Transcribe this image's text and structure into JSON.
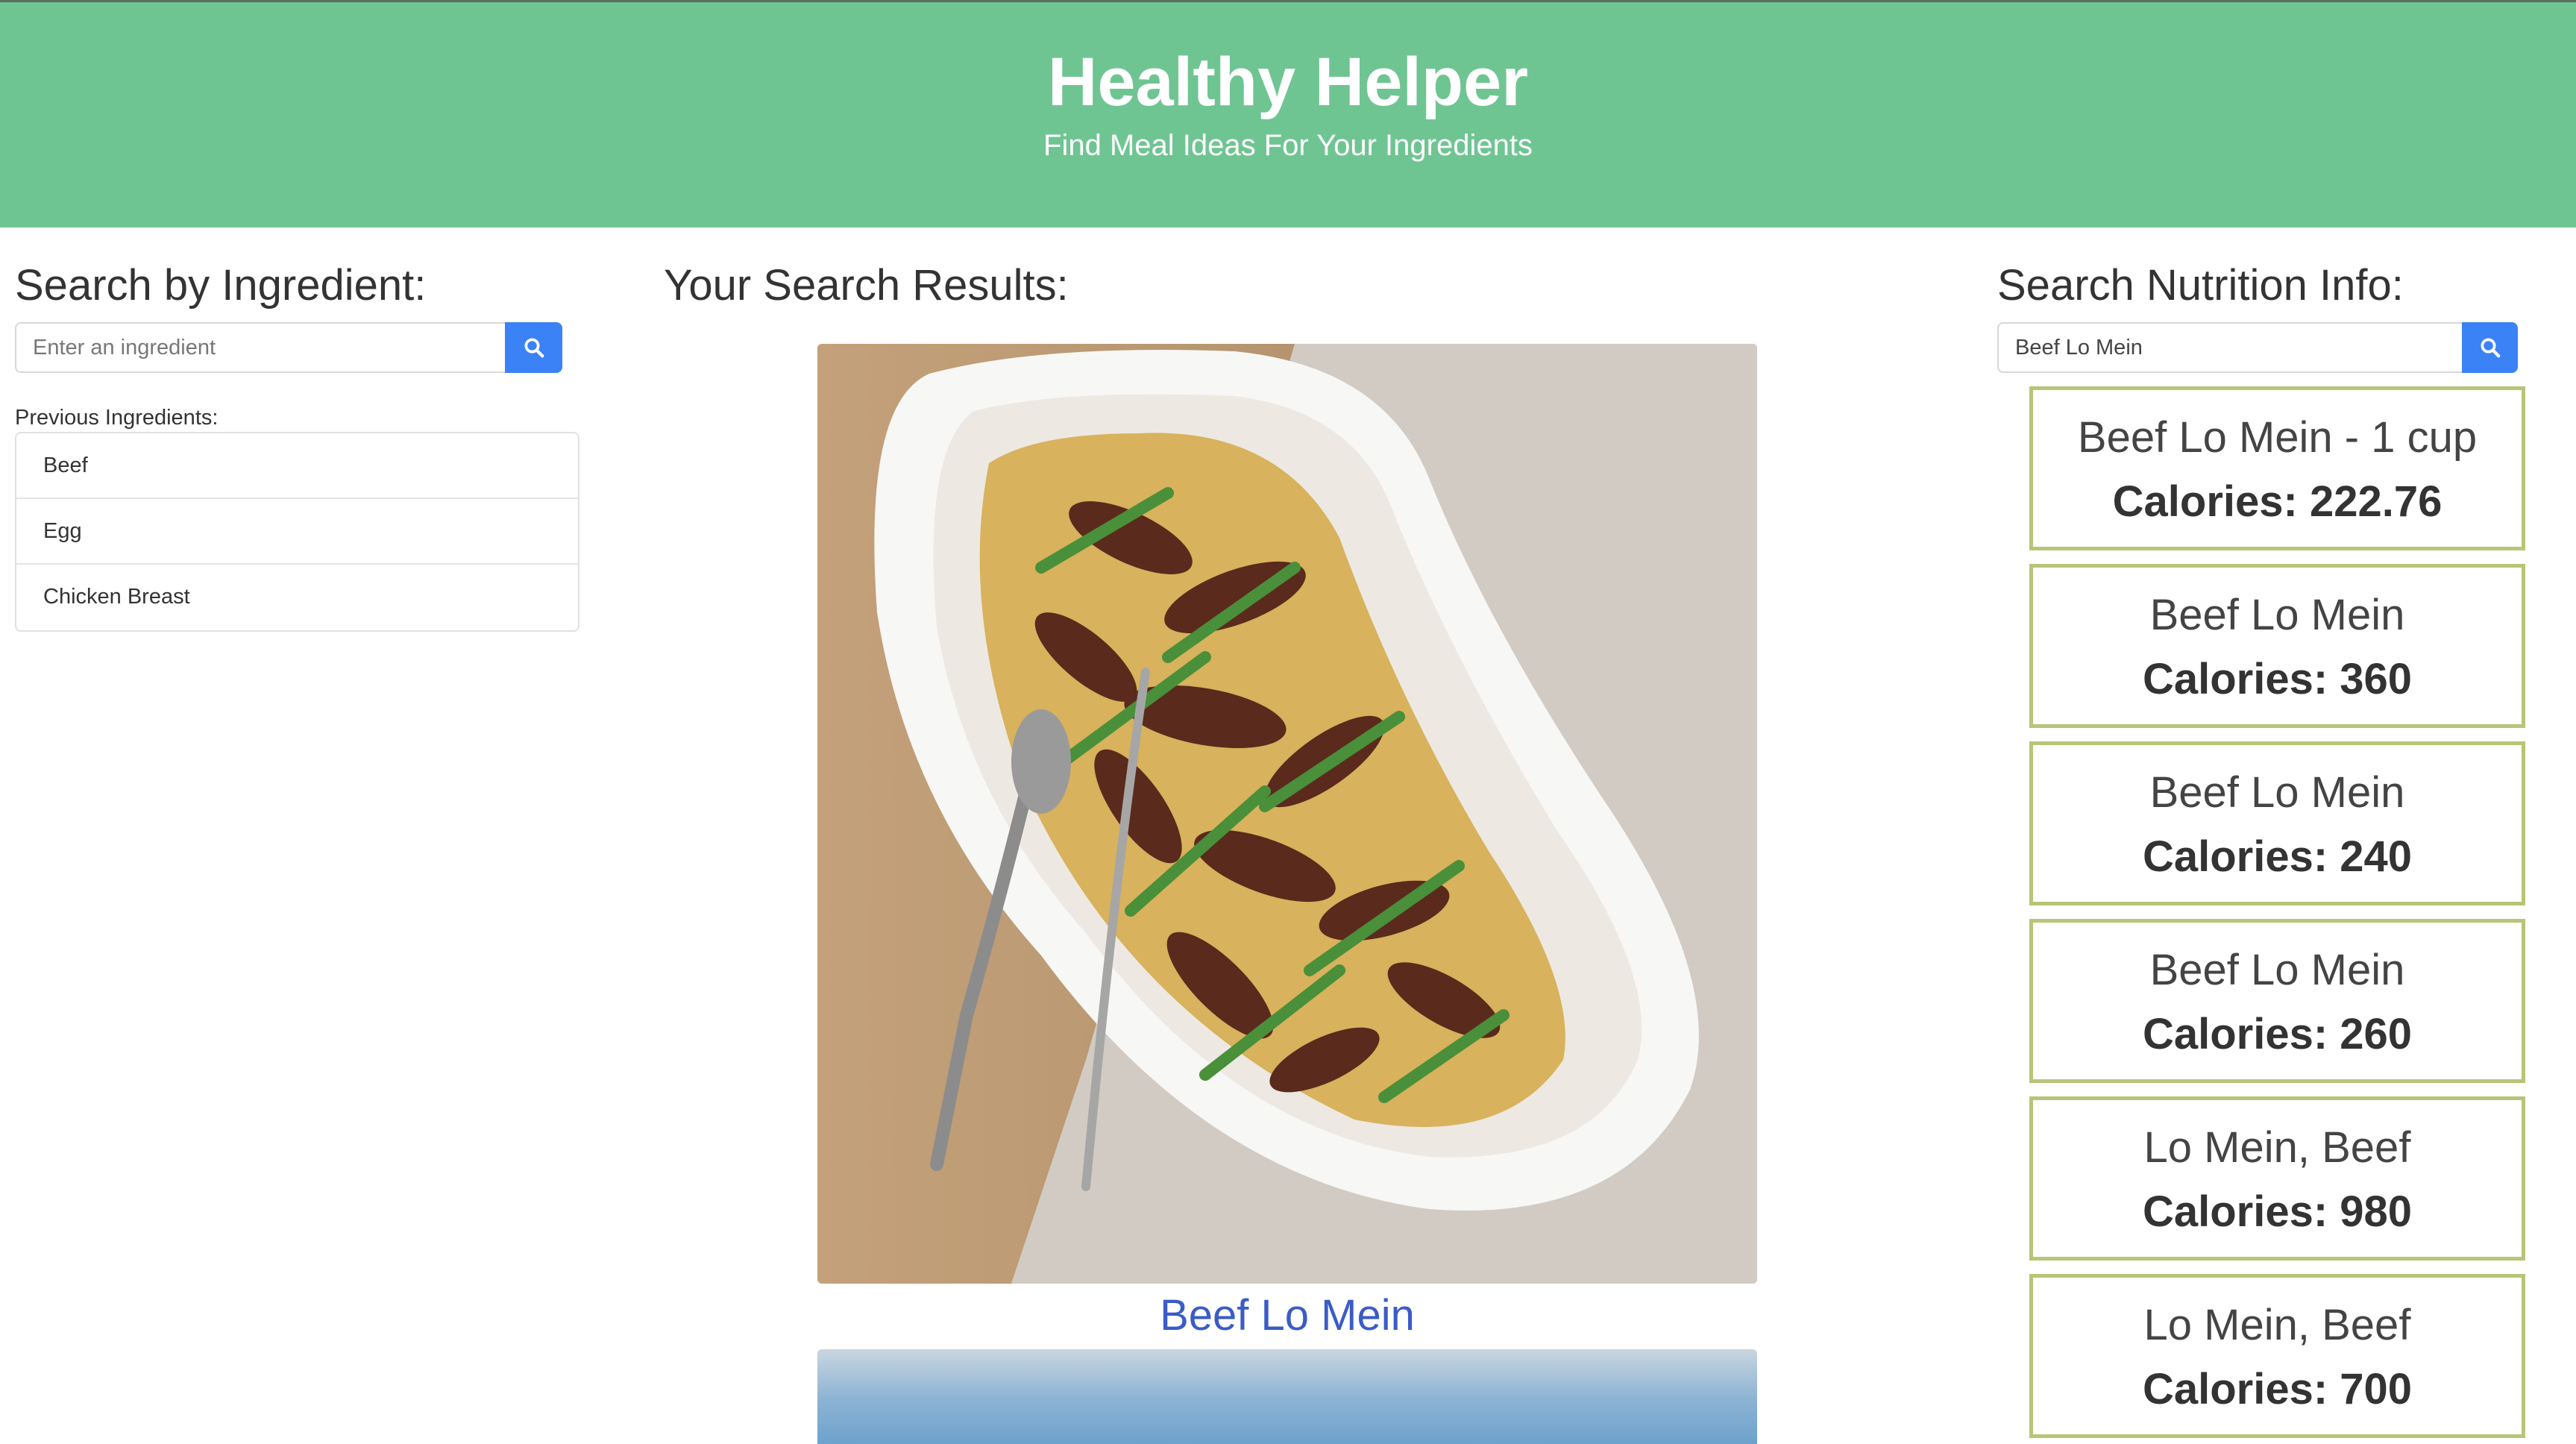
{
  "header": {
    "title": "Healthy Helper",
    "subtitle": "Find Meal Ideas For Your Ingredients"
  },
  "ingredient_search": {
    "heading": "Search by Ingredient:",
    "placeholder": "Enter an ingredient",
    "value": "",
    "button_icon": "search-icon"
  },
  "previous": {
    "label": "Previous Ingredients:",
    "items": [
      "Beef",
      "Egg",
      "Chicken Breast"
    ]
  },
  "results": {
    "heading": "Your Search Results:",
    "items": [
      {
        "name": "Beef Lo Mein"
      }
    ]
  },
  "nutrition": {
    "heading": "Search Nutrition Info:",
    "value": "Beef Lo Mein",
    "button_icon": "search-icon",
    "cards": [
      {
        "food": "Beef Lo Mein - 1 cup",
        "calories": "Calories: 222.76"
      },
      {
        "food": "Beef Lo Mein",
        "calories": "Calories: 360"
      },
      {
        "food": "Beef Lo Mein",
        "calories": "Calories: 240"
      },
      {
        "food": "Beef Lo Mein",
        "calories": "Calories: 260"
      },
      {
        "food": "Lo Mein, Beef",
        "calories": "Calories: 980"
      },
      {
        "food": "Lo Mein, Beef",
        "calories": "Calories: 700"
      }
    ]
  },
  "colors": {
    "header_bg": "#6fc592",
    "search_button": "#3a82f5",
    "result_link": "#3a5cc7",
    "card_border": "#b9c477"
  }
}
